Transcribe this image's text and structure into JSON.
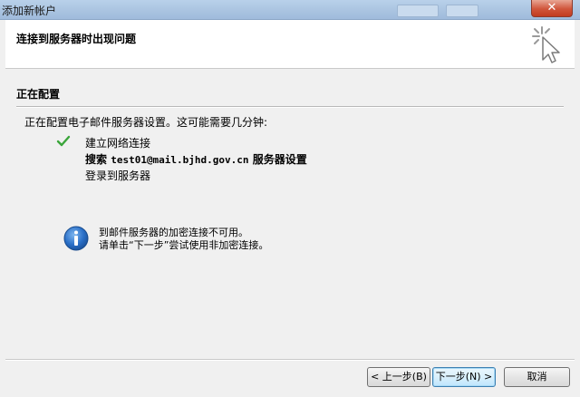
{
  "window": {
    "title": "添加新帐户"
  },
  "header": {
    "heading": "连接到服务器时出现问题"
  },
  "section": {
    "title": "正在配置"
  },
  "progress": {
    "intro": "正在配置电子邮件服务器设置。这可能需要几分钟:",
    "steps": [
      {
        "label": "建立网络连接",
        "status": "done"
      },
      {
        "prefix": "搜索",
        "email": "test01@mail.bjhd.gov.cn",
        "suffix": "服务器设置",
        "status": "current"
      },
      {
        "label": "登录到服务器",
        "status": "pending"
      }
    ]
  },
  "info": {
    "line1": "到邮件服务器的加密连接不可用。",
    "line2": "请单击“下一步”尝试使用非加密连接。"
  },
  "buttons": {
    "back": "< 上一步(B)",
    "next": "下一步(N) >",
    "cancel": "取消"
  },
  "colors": {
    "check": "#3aa53a",
    "info_icon": "#1f5fb5",
    "close_button": "#c8432a"
  },
  "icons": [
    "cursor-click-icon",
    "check-icon",
    "info-icon"
  ]
}
